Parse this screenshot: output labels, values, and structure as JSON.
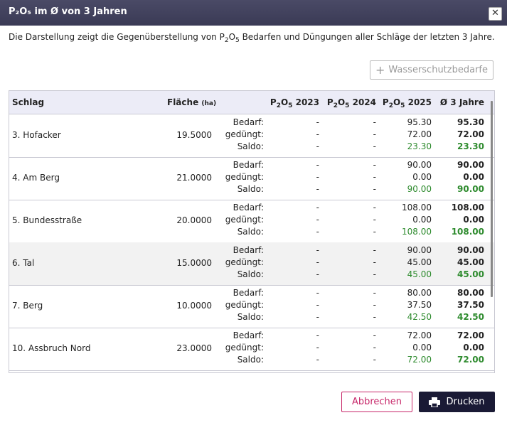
{
  "dialog": {
    "title": "P₂O₅ im Ø von 3 Jahren",
    "close_icon": "close-icon",
    "description_pre": "Die Darstellung zeigt die Gegenüberstellung von P",
    "description_sub1": "2",
    "description_mid": "O",
    "description_sub2": "5",
    "description_post": " Bedarfen und Düngungen aller Schläge der letzten 3 Jahre."
  },
  "toolbar": {
    "wasserschutz_icon": "plus-icon",
    "wasserschutz_label": "Wasserschutzbedarfe"
  },
  "table": {
    "headers": {
      "schlag": "Schlag",
      "flaeche": "Fläche",
      "flaeche_unit": "(ha)",
      "y2023_pre": "P",
      "y2023_sub1": "2",
      "y2023_mid": "O",
      "y2023_sub2": "5",
      "y2023_post": " 2023",
      "y2024_pre": "P",
      "y2024_sub1": "2",
      "y2024_mid": "O",
      "y2024_sub2": "5",
      "y2024_post": " 2024",
      "y2025_pre": "P",
      "y2025_sub1": "2",
      "y2025_mid": "O",
      "y2025_sub2": "5",
      "y2025_post": " 2025",
      "avg": "Ø 3 Jahre"
    },
    "labels": {
      "bedarf": "Bedarf:",
      "geduengt": "gedüngt:",
      "saldo": "Saldo:"
    },
    "rows": [
      {
        "name": "3. Hofacker",
        "area": "19.5000",
        "y2023": [
          "-",
          "-",
          "-"
        ],
        "y2024": [
          "-",
          "-",
          "-"
        ],
        "y2025": [
          "95.30",
          "72.00",
          "23.30"
        ],
        "avg": [
          "95.30",
          "72.00",
          "23.30"
        ]
      },
      {
        "name": "4. Am Berg",
        "area": "21.0000",
        "y2023": [
          "-",
          "-",
          "-"
        ],
        "y2024": [
          "-",
          "-",
          "-"
        ],
        "y2025": [
          "90.00",
          "0.00",
          "90.00"
        ],
        "avg": [
          "90.00",
          "0.00",
          "90.00"
        ]
      },
      {
        "name": "5. Bundesstraße",
        "area": "20.0000",
        "y2023": [
          "-",
          "-",
          "-"
        ],
        "y2024": [
          "-",
          "-",
          "-"
        ],
        "y2025": [
          "108.00",
          "0.00",
          "108.00"
        ],
        "avg": [
          "108.00",
          "0.00",
          "108.00"
        ]
      },
      {
        "name": "6. Tal",
        "area": "15.0000",
        "y2023": [
          "-",
          "-",
          "-"
        ],
        "y2024": [
          "-",
          "-",
          "-"
        ],
        "y2025": [
          "90.00",
          "45.00",
          "45.00"
        ],
        "avg": [
          "90.00",
          "45.00",
          "45.00"
        ]
      },
      {
        "name": "7. Berg",
        "area": "10.0000",
        "y2023": [
          "-",
          "-",
          "-"
        ],
        "y2024": [
          "-",
          "-",
          "-"
        ],
        "y2025": [
          "80.00",
          "37.50",
          "42.50"
        ],
        "avg": [
          "80.00",
          "37.50",
          "42.50"
        ]
      },
      {
        "name": "10. Assbruch Nord",
        "area": "23.0000",
        "y2023": [
          "-",
          "-",
          "-"
        ],
        "y2024": [
          "-",
          "-",
          "-"
        ],
        "y2025": [
          "72.00",
          "0.00",
          "72.00"
        ],
        "avg": [
          "72.00",
          "0.00",
          "72.00"
        ]
      }
    ]
  },
  "footer": {
    "cancel_label": "Abbrechen",
    "print_icon": "printer-icon",
    "print_label": "Drucken"
  },
  "colors": {
    "titlebar": "#3f3f5c",
    "saldo_positive": "#2e8b2e",
    "cancel_accent": "#c7286a",
    "print_button": "#1a1a35"
  }
}
